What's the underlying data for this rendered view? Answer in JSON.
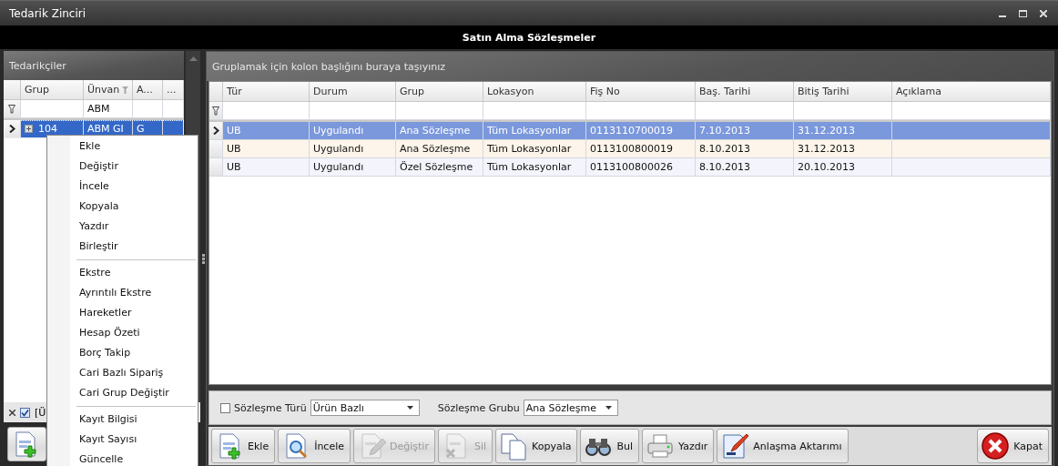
{
  "window": {
    "title": "Tedarik Zinciri"
  },
  "caption": "Satın Alma Sözleşmeler",
  "left_panel": {
    "title": "Tedarikçiler",
    "columns": [
      {
        "label": "Grup",
        "filter_icon": false
      },
      {
        "label": "Ünvan",
        "filter_icon": true,
        "filter_value": "ABM"
      },
      {
        "label": "A...",
        "filter_icon": false
      },
      {
        "label": "...",
        "filter_icon": false
      }
    ],
    "rows": [
      {
        "cells": [
          "104",
          "ABM GI",
          "G"
        ],
        "selected": true,
        "expanded": false
      }
    ],
    "footer": {
      "filter_enabled": true,
      "filter_text": "[Ü"
    }
  },
  "context_menu": [
    {
      "items": [
        "Ekle",
        "Değiştir",
        "İncele",
        "Kopyala",
        "Yazdır",
        "Birleştir"
      ]
    },
    {
      "items": [
        "Ekstre",
        "Ayrıntılı Ekstre",
        "Hareketler",
        "Hesap Özeti",
        "Borç Takip",
        "Cari Bazlı Sipariş",
        "Cari Grup Değiştir"
      ]
    },
    {
      "items": [
        "Kayıt Bilgisi",
        "Kayıt Sayısı",
        "Güncelle"
      ]
    }
  ],
  "right_panel": {
    "group_hint": "Gruplamak için kolon başlığını buraya taşıyınız",
    "columns": [
      {
        "label": "Tür"
      },
      {
        "label": "Durum"
      },
      {
        "label": "Grup"
      },
      {
        "label": "Lokasyon"
      },
      {
        "label": "Fiş No"
      },
      {
        "label": "Baş. Tarihi"
      },
      {
        "label": "Bitiş Tarihi"
      },
      {
        "label": "Açıklama"
      }
    ],
    "rows": [
      {
        "cells": [
          "UB",
          "Uygulandı",
          "Ana Sözleşme",
          "Tüm Lokasyonlar",
          "0113110700019",
          "7.10.2013",
          "31.12.2013"
        ],
        "selected": true
      },
      {
        "cells": [
          "UB",
          "Uygulandı",
          "Ana Sözleşme",
          "Tüm Lokasyonlar",
          "0113100800019",
          "8.10.2013",
          "31.12.2013"
        ],
        "selected": false
      },
      {
        "cells": [
          "UB",
          "Uygulandı",
          "Özel Sözleşme",
          "Tüm Lokasyonlar",
          "0113100800026",
          "8.10.2013",
          "20.10.2013"
        ],
        "selected": false
      }
    ]
  },
  "options": {
    "contract_type": {
      "label": "Sözleşme Türü",
      "checked": false,
      "value": "Ürün Bazlı"
    },
    "contract_group": {
      "label": "Sözleşme Grubu",
      "value": "Ana Sözleşme"
    }
  },
  "toolbar": [
    {
      "label": "Ekle",
      "kind": "add",
      "disabled": false
    },
    {
      "label": "İncele",
      "kind": "inspect",
      "disabled": false
    },
    {
      "label": "Değiştir",
      "kind": "edit",
      "disabled": true
    },
    {
      "label": "Sil",
      "kind": "delete",
      "disabled": true
    },
    {
      "label": "Kopyala",
      "kind": "copy",
      "disabled": false
    },
    {
      "label": "Bul",
      "kind": "find",
      "disabled": false
    },
    {
      "label": "Yazdır",
      "kind": "print",
      "disabled": false
    },
    {
      "label": "Anlaşma Aktarımı",
      "kind": "transfer",
      "disabled": false
    }
  ],
  "close_button": {
    "label": "Kapat"
  }
}
